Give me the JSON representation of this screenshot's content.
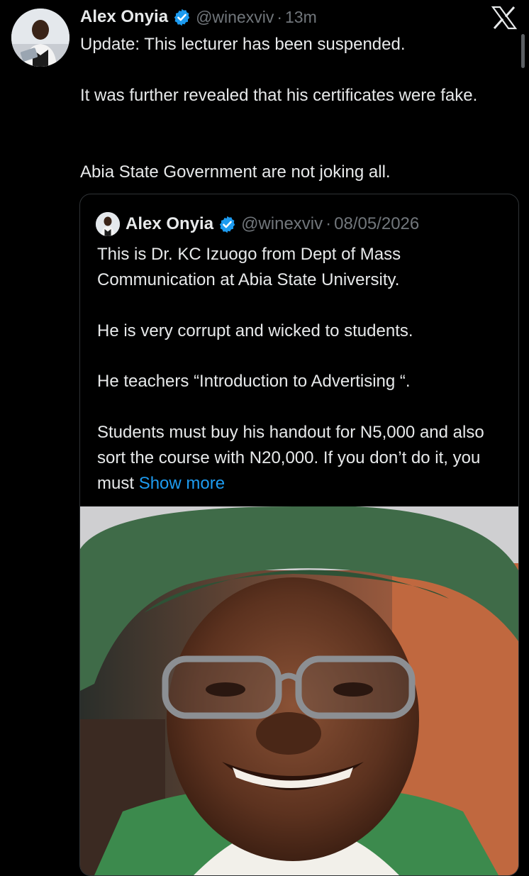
{
  "tweet": {
    "author_name": "Alex Onyia",
    "handle": "@winexviv",
    "separator": "·",
    "time": "13m",
    "lines": [
      "Update: This lecturer has been suspended.",
      "It was further revealed that his certificates were fake.",
      "Abia State Government are not joking all."
    ]
  },
  "quoted": {
    "author_name": "Alex Onyia",
    "handle": "@winexviv",
    "separator": "·",
    "date": "08/05/2026",
    "lines": [
      "This is Dr. KC Izuogo from Dept of Mass Communication at Abia State University.",
      "He is very corrupt and wicked to students.",
      "He teachers “Introduction to Advertising “.",
      "Students must buy his handout for N5,000 and also sort the course with N20,000. If you don’t do it, you must"
    ],
    "show_more": "Show more"
  },
  "icons": {
    "verified": "verified-badge-icon",
    "platform": "x-logo-icon"
  },
  "colors": {
    "background": "#000000",
    "text": "#e7e9ea",
    "secondary": "#71767b",
    "link": "#1d9bf0",
    "verified": "#1d9bf0",
    "border": "#2f3336",
    "cap_green": "#3f6b48"
  }
}
